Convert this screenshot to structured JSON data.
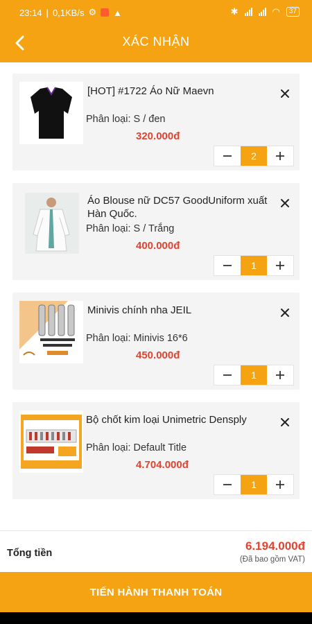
{
  "status_bar": {
    "time": "23:14",
    "net_speed": "0,1KB/s",
    "battery": "37"
  },
  "header": {
    "title": "XÁC NHẬN"
  },
  "colors": {
    "accent": "#f6a313",
    "price": "#e0432f",
    "card_bg": "#f4f4f4"
  },
  "cart": {
    "items": [
      {
        "name": "[HOT] #1722 Áo Nữ Maevn",
        "variant": "Phân loại: S / đen",
        "price": "320.000đ",
        "quantity": "2",
        "thumb_icon": "black-scrub-top"
      },
      {
        "name": "Áo Blouse nữ DC57 GoodUniform xuất Hàn Quốc.",
        "variant": "Phân loại: S / Trắng",
        "price": "400.000đ",
        "quantity": "1",
        "thumb_icon": "white-lab-coat"
      },
      {
        "name": "Minivis chính nha JEIL",
        "variant": "Phân loại: Minivis 16*6",
        "price": "450.000đ",
        "quantity": "1",
        "thumb_icon": "screw-pack"
      },
      {
        "name": "Bộ chốt kim loại Unimetric Densply",
        "variant": "Phân loại: Default Title",
        "price": "4.704.000đ",
        "quantity": "1",
        "thumb_icon": "post-kit-box"
      }
    ]
  },
  "footer": {
    "total_label": "Tổng tiền",
    "total_amount": "6.194.000đ",
    "vat_note": "(Đã bao gồm VAT)",
    "checkout_label": "TIẾN HÀNH THANH TOÁN"
  }
}
